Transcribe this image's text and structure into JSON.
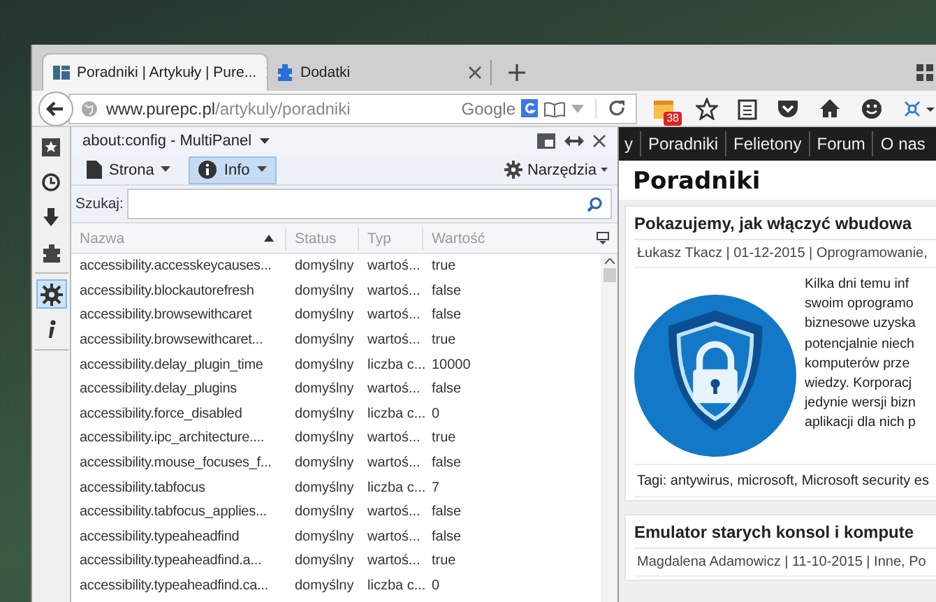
{
  "tabs": [
    {
      "label": "Poradniki | Artykuły | Pure...",
      "selected": true
    },
    {
      "label": "Dodatki",
      "selected": false
    }
  ],
  "address_bar": {
    "host": "www.purepc.pl",
    "path": "/artykuly/poradniki",
    "search_engine": "Google"
  },
  "toolbar": {
    "badge": "38"
  },
  "sidebar": {
    "items": [
      {
        "selected": false
      },
      {
        "selected": false
      },
      {
        "selected": false
      },
      {
        "selected": false
      },
      {
        "selected": true
      },
      {
        "selected": false
      }
    ]
  },
  "panel": {
    "title": "about:config - MultiPanel",
    "buttons": [
      {
        "label": "Strona",
        "selected": false
      },
      {
        "label": "Info",
        "selected": true
      }
    ],
    "tools": "Narzędzia",
    "search_label": "Szukaj:",
    "columns": [
      {
        "label": "Nazwa",
        "sorted": true
      },
      {
        "label": "Status",
        "sorted": false
      },
      {
        "label": "Typ",
        "sorted": false
      },
      {
        "label": "Wartość",
        "sorted": false
      }
    ],
    "rows": [
      {
        "name": "accessibility.accesskeycauses...",
        "status": "domyślny",
        "type": "wartoś...",
        "value": "true"
      },
      {
        "name": "accessibility.blockautorefresh",
        "status": "domyślny",
        "type": "wartoś...",
        "value": "false"
      },
      {
        "name": "accessibility.browsewithcaret",
        "status": "domyślny",
        "type": "wartoś...",
        "value": "false"
      },
      {
        "name": "accessibility.browsewithcaret...",
        "status": "domyślny",
        "type": "wartoś...",
        "value": "true"
      },
      {
        "name": "accessibility.delay_plugin_time",
        "status": "domyślny",
        "type": "liczba c...",
        "value": "10000"
      },
      {
        "name": "accessibility.delay_plugins",
        "status": "domyślny",
        "type": "wartoś...",
        "value": "false"
      },
      {
        "name": "accessibility.force_disabled",
        "status": "domyślny",
        "type": "liczba c...",
        "value": "0"
      },
      {
        "name": "accessibility.ipc_architecture....",
        "status": "domyślny",
        "type": "wartoś...",
        "value": "true"
      },
      {
        "name": "accessibility.mouse_focuses_f...",
        "status": "domyślny",
        "type": "wartoś...",
        "value": "false"
      },
      {
        "name": "accessibility.tabfocus",
        "status": "domyślny",
        "type": "liczba c...",
        "value": "7"
      },
      {
        "name": "accessibility.tabfocus_applies...",
        "status": "domyślny",
        "type": "wartoś...",
        "value": "false"
      },
      {
        "name": "accessibility.typeaheadfind",
        "status": "domyślny",
        "type": "wartoś...",
        "value": "false"
      },
      {
        "name": "accessibility.typeaheadfind.a...",
        "status": "domyślny",
        "type": "wartoś...",
        "value": "true"
      },
      {
        "name": "accessibility.typeaheadfind.ca...",
        "status": "domyślny",
        "type": "liczba c...",
        "value": "0"
      }
    ]
  },
  "web": {
    "nav": [
      "y",
      "Poradniki",
      "Felietony",
      "Forum",
      "O nas"
    ],
    "heading": "Poradniki",
    "articles": [
      {
        "title": "Pokazujemy, jak włączyć wbudowa",
        "meta": "Łukasz Tkacz | 01-12-2015 | Oprogramowanie,",
        "lines": [
          "Kilka dni temu inf",
          "swoim oprogramo",
          "biznesowe uzyska",
          "potencjalnie niech",
          "komputerów prze",
          "wiedzy. Korporacj",
          "jedynie wersji bizn",
          "aplikacji dla nich p"
        ],
        "tags": "Tagi: antywirus, microsoft, Microsoft security es"
      },
      {
        "title": "Emulator starych konsol i kompute",
        "meta": "Magdalena Adamowicz | 11-10-2015 | Inne, Po"
      }
    ]
  }
}
